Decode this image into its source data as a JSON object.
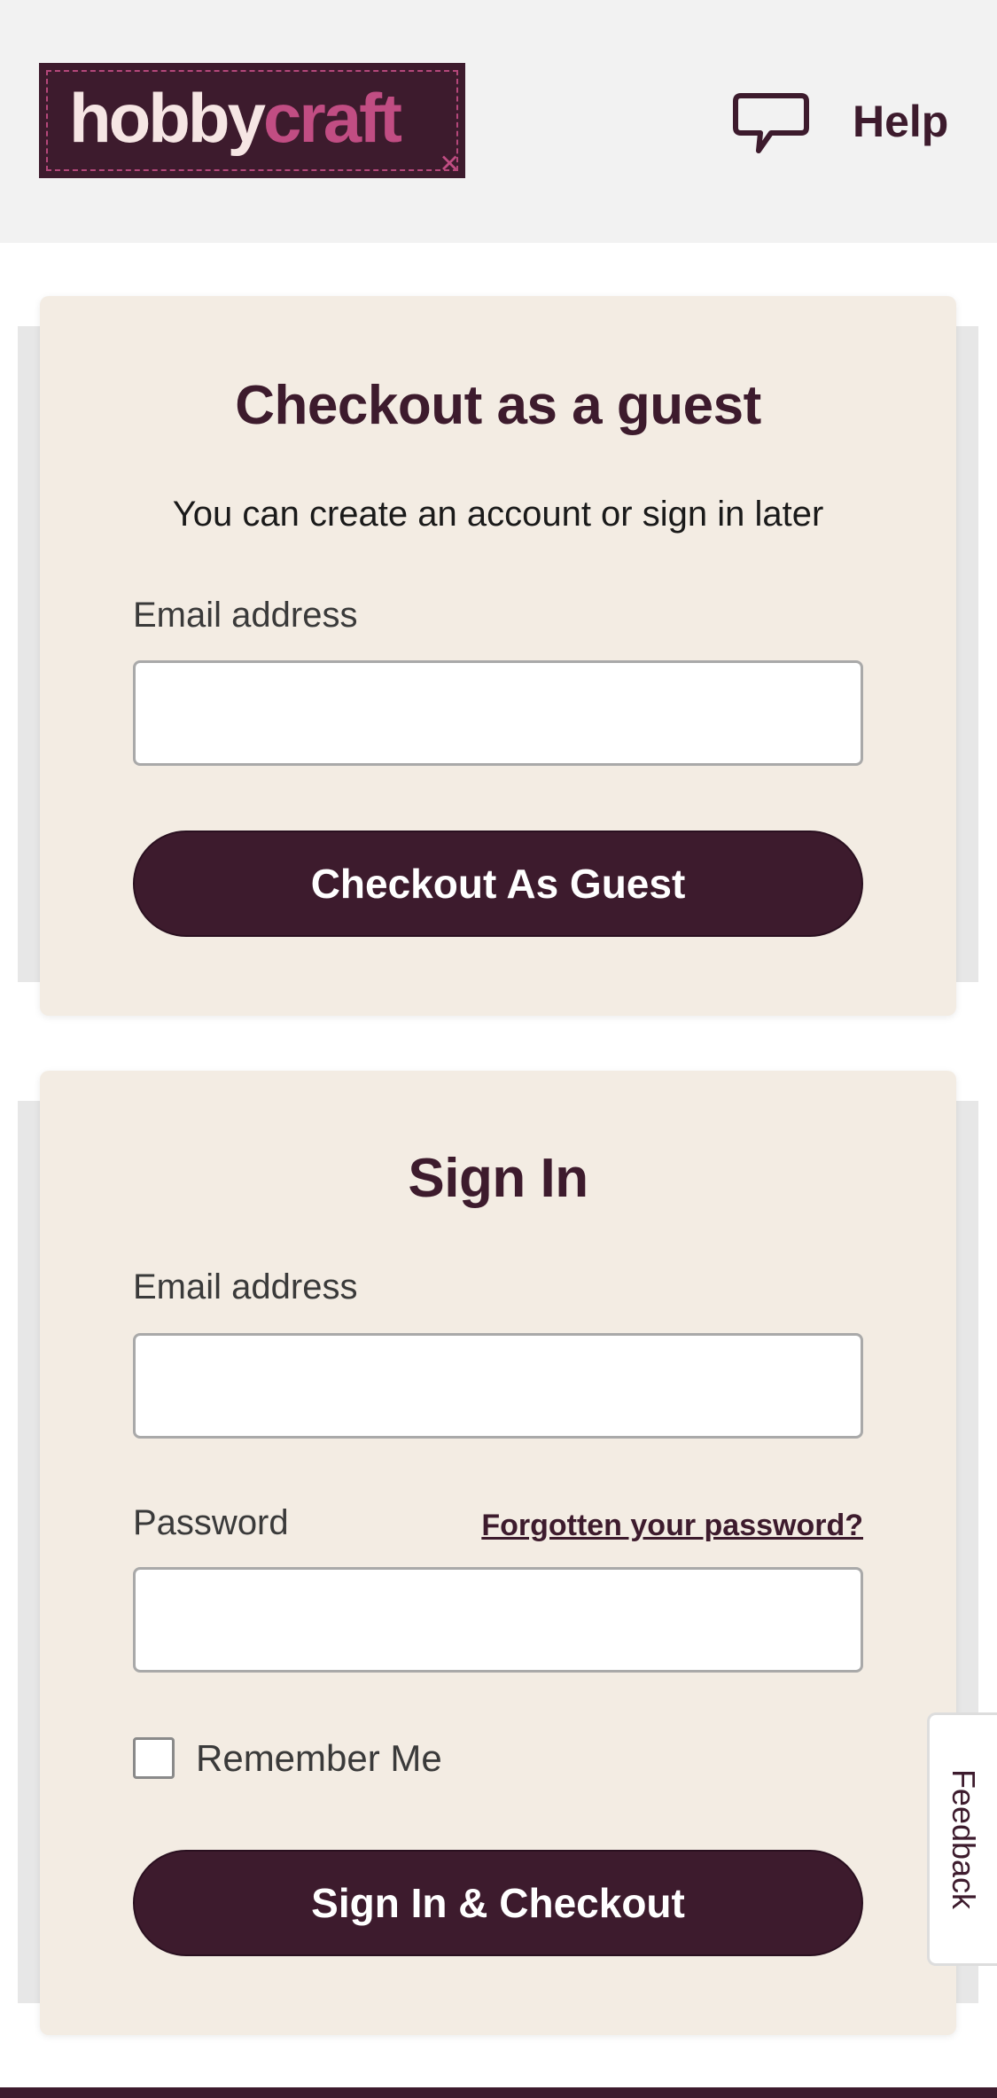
{
  "header": {
    "logo": {
      "part1": "hobby",
      "part2": "craft"
    },
    "help": {
      "label": "Help",
      "icon": "speech-bubble-icon"
    }
  },
  "guest": {
    "title": "Checkout as a guest",
    "subtitle": "You can create an account or sign in later",
    "email_label": "Email address",
    "email_value": "",
    "button_label": "Checkout As Guest"
  },
  "signin": {
    "title": "Sign In",
    "email_label": "Email address",
    "email_value": "",
    "password_label": "Password",
    "password_value": "",
    "forgot_label": "Forgotten your password?",
    "remember_label": "Remember Me",
    "remember_checked": false,
    "button_label": "Sign In & Checkout"
  },
  "feedback": {
    "label": "Feedback"
  },
  "colors": {
    "brand": "#3d1b2d",
    "accent": "#c14d83",
    "card_bg": "#f3ece3",
    "header_bg": "#f2f2f2"
  }
}
